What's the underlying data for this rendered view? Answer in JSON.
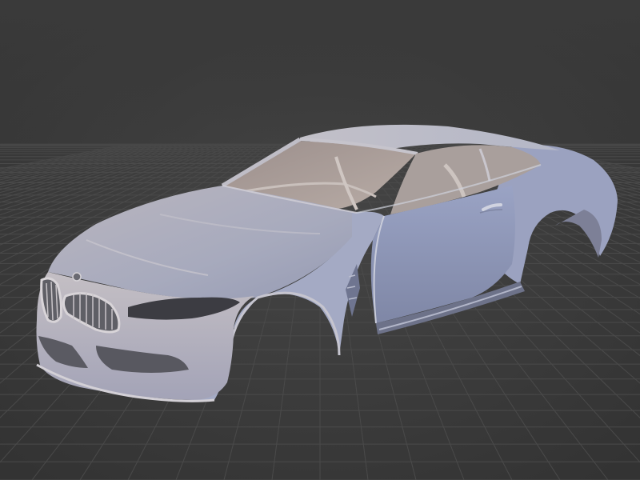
{
  "viewport": {
    "background_color": "#3d3d3d",
    "grid_color": "#474747",
    "model_color": "#a9adc2",
    "icon": "car-body-model"
  }
}
